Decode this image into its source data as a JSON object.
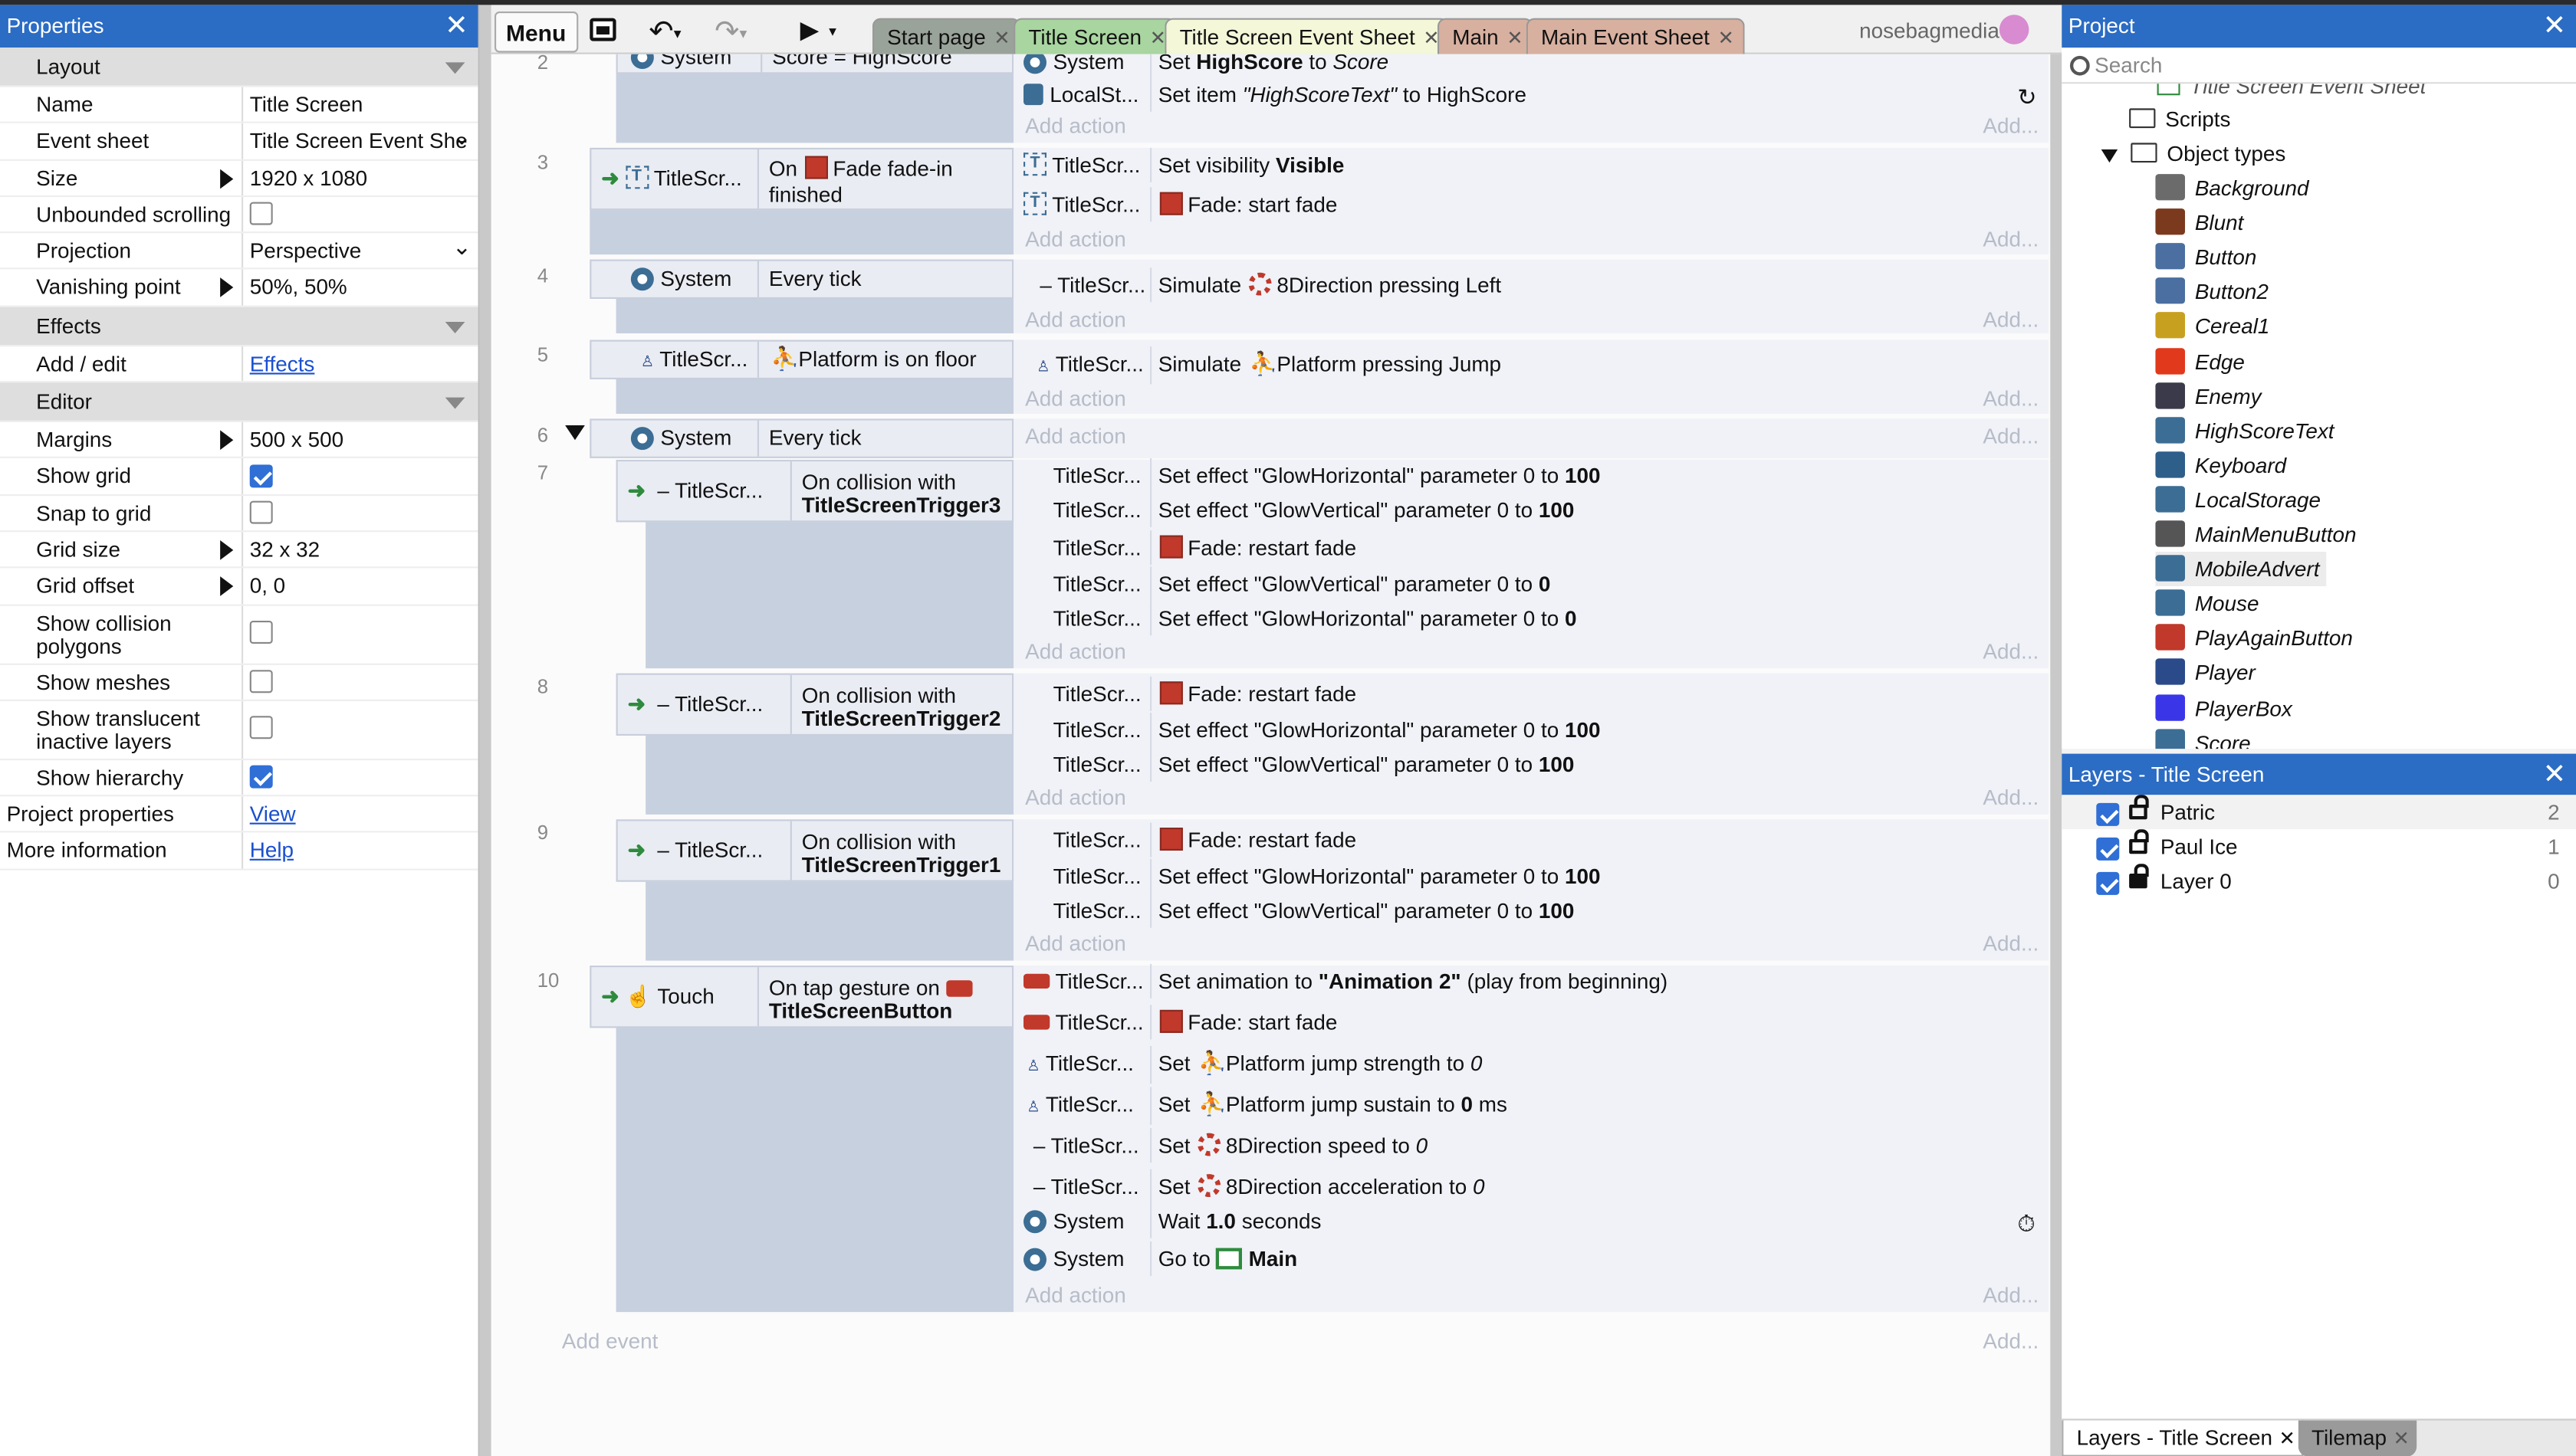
{
  "props": {
    "title": "Properties",
    "layout_cat": "Layout",
    "rows": [
      {
        "k": "Name",
        "v": "Title Screen"
      },
      {
        "k": "Event sheet",
        "v": "Title Screen Event She"
      },
      {
        "k": "Size",
        "v": "1920 x 1080"
      },
      {
        "k": "Unbounded scrolling",
        "v": ""
      },
      {
        "k": "Projection",
        "v": "Perspective"
      },
      {
        "k": "Vanishing point",
        "v": "50%, 50%"
      }
    ],
    "effects_cat": "Effects",
    "addedit": "Add / edit",
    "effects_link": "Effects",
    "editor_cat": "Editor",
    "margins": "Margins",
    "margins_v": "500 x 500",
    "showgrid": "Show grid",
    "snap": "Snap to grid",
    "gridsize": "Grid size",
    "gridsize_v": "32 x 32",
    "gridoff": "Grid offset",
    "gridoff_v": "0, 0",
    "collision": "Show collision polygons",
    "meshes": "Show meshes",
    "translucent": "Show translucent inactive layers",
    "hierarchy": "Show hierarchy",
    "projprops": "Project properties",
    "view": "View",
    "moreinfo": "More information",
    "help": "Help"
  },
  "toolbar": {
    "menu": "Menu",
    "tabs": [
      "Start page",
      "Title Screen",
      "Title Screen Event Sheet",
      "Main",
      "Main Event Sheet"
    ],
    "user": "nosebagmedia"
  },
  "sheet": {
    "e2": {
      "num": "2",
      "obj": "System",
      "cond": "Score = HighScore",
      "a1o": "System",
      "a1": "Set",
      "a1b": "HighScore",
      "a1c": "to",
      "a1d": "Score",
      "a2o": "LocalSt...",
      "a2": "Set item",
      "a2b": "\"HighScoreText\"",
      "a2c": "to HighScore"
    },
    "e3": {
      "num": "3",
      "obj": "TitleScr...",
      "cond1": "On",
      "cond2": "Fade fade-in",
      "cond3": "finished",
      "a1o": "TitleScr...",
      "a1": "Set visibility",
      "a1b": "Visible",
      "a2o": "TitleScr...",
      "a2": "Fade: start fade"
    },
    "e4": {
      "num": "4",
      "obj": "System",
      "cond": "Every tick",
      "a1o": "TitleScr...",
      "a1": "Simulate",
      "a1b": "8Direction pressing Left"
    },
    "e5": {
      "num": "5",
      "obj": "TitleScr...",
      "cond": "Platform is on floor",
      "a1o": "TitleScr...",
      "a1": "Simulate",
      "a1b": "Platform pressing Jump"
    },
    "e6": {
      "num": "6",
      "obj": "System",
      "cond": "Every tick"
    },
    "e7": {
      "num": "7",
      "obj": "TitleScr...",
      "cond1": "On collision with",
      "cond2": "TitleScreenTrigger3",
      "acts": [
        [
          "TitleScr...",
          "Set effect \"GlowHorizontal\" parameter 0 to",
          "100"
        ],
        [
          "TitleScr...",
          "Set effect \"GlowVertical\" parameter 0 to",
          "100"
        ],
        [
          "TitleScr...",
          "Fade: restart fade",
          ""
        ],
        [
          "TitleScr...",
          "Set effect \"GlowVertical\" parameter 0 to",
          "0"
        ],
        [
          "TitleScr...",
          "Set effect \"GlowHorizontal\" parameter 0 to",
          "0"
        ]
      ]
    },
    "e8": {
      "num": "8",
      "obj": "TitleScr...",
      "cond1": "On collision with",
      "cond2": "TitleScreenTrigger2",
      "acts": [
        [
          "TitleScr...",
          "Fade: restart fade",
          ""
        ],
        [
          "TitleScr...",
          "Set effect \"GlowHorizontal\" parameter 0 to",
          "100"
        ],
        [
          "TitleScr...",
          "Set effect \"GlowVertical\" parameter 0 to",
          "100"
        ]
      ]
    },
    "e9": {
      "num": "9",
      "obj": "TitleScr...",
      "cond1": "On collision with",
      "cond2": "TitleScreenTrigger1",
      "acts": [
        [
          "TitleScr...",
          "Fade: restart fade",
          ""
        ],
        [
          "TitleScr...",
          "Set effect \"GlowHorizontal\" parameter 0 to",
          "100"
        ],
        [
          "TitleScr...",
          "Set effect \"GlowVertical\" parameter 0 to",
          "100"
        ]
      ]
    },
    "e10": {
      "num": "10",
      "obj": "Touch",
      "cond1": "On tap gesture on",
      "cond2": "TitleScreenButton",
      "a1o": "TitleScr...",
      "a1": "Set animation to",
      "a1b": "\"Animation 2\"",
      "a1c": "(play from beginning)",
      "a2o": "TitleScr...",
      "a2": "Fade: start fade",
      "a3o": "TitleScr...",
      "a3": "Set",
      "a3b": "Platform jump strength to",
      "a3c": "0",
      "a4o": "TitleScr...",
      "a4": "Set",
      "a4b": "Platform jump sustain to",
      "a4c": "0",
      "a4d": "ms",
      "a5o": "TitleScr...",
      "a5": "Set",
      "a5b": "8Direction speed to",
      "a5c": "0",
      "a6o": "TitleScr...",
      "a6": "Set",
      "a6b": "8Direction acceleration to",
      "a6c": "0",
      "a7o": "System",
      "a7": "Wait",
      "a7b": "1.0",
      "a7c": "seconds",
      "a8o": "System",
      "a8": "Go to",
      "a8b": "Main"
    },
    "addaction": "Add action",
    "adddots": "Add...",
    "addevent": "Add event"
  },
  "project": {
    "title": "Project",
    "search": "Search",
    "partial": "Title Screen Event Sheet",
    "scripts": "Scripts",
    "objtypes": "Object types",
    "objects": [
      {
        "name": "Background",
        "color": "#6b6b6b"
      },
      {
        "name": "Blunt",
        "color": "#7b3a1e"
      },
      {
        "name": "Button",
        "color": "#4a6fa0"
      },
      {
        "name": "Button2",
        "color": "#4a6fa0"
      },
      {
        "name": "Cereal1",
        "color": "#c8a020"
      },
      {
        "name": "Edge",
        "color": "#e0391c"
      },
      {
        "name": "Enemy",
        "color": "#3a3a4a"
      },
      {
        "name": "HighScoreText",
        "color": "#3c6d94"
      },
      {
        "name": "Keyboard",
        "color": "#2e5e8a"
      },
      {
        "name": "LocalStorage",
        "color": "#3c6d94"
      },
      {
        "name": "MainMenuButton",
        "color": "#555555"
      },
      {
        "name": "MobileAdvert",
        "color": "#3c6d94"
      },
      {
        "name": "Mouse",
        "color": "#3c6d94"
      },
      {
        "name": "PlayAgainButton",
        "color": "#c0392b"
      },
      {
        "name": "Player",
        "color": "#2a4a8a"
      },
      {
        "name": "PlayerBox",
        "color": "#3a36e8"
      },
      {
        "name": "Score",
        "color": "#3c6d94"
      }
    ]
  },
  "layers": {
    "title": "Layers - Title Screen",
    "rows": [
      {
        "name": "Patric",
        "n": "2"
      },
      {
        "name": "Paul Ice",
        "n": "1"
      },
      {
        "name": "Layer 0",
        "n": "0"
      }
    ],
    "tab1": "Layers - Title Screen",
    "tab2": "Tilemap"
  },
  "colors": {
    "accent": "#2b6cc4"
  }
}
